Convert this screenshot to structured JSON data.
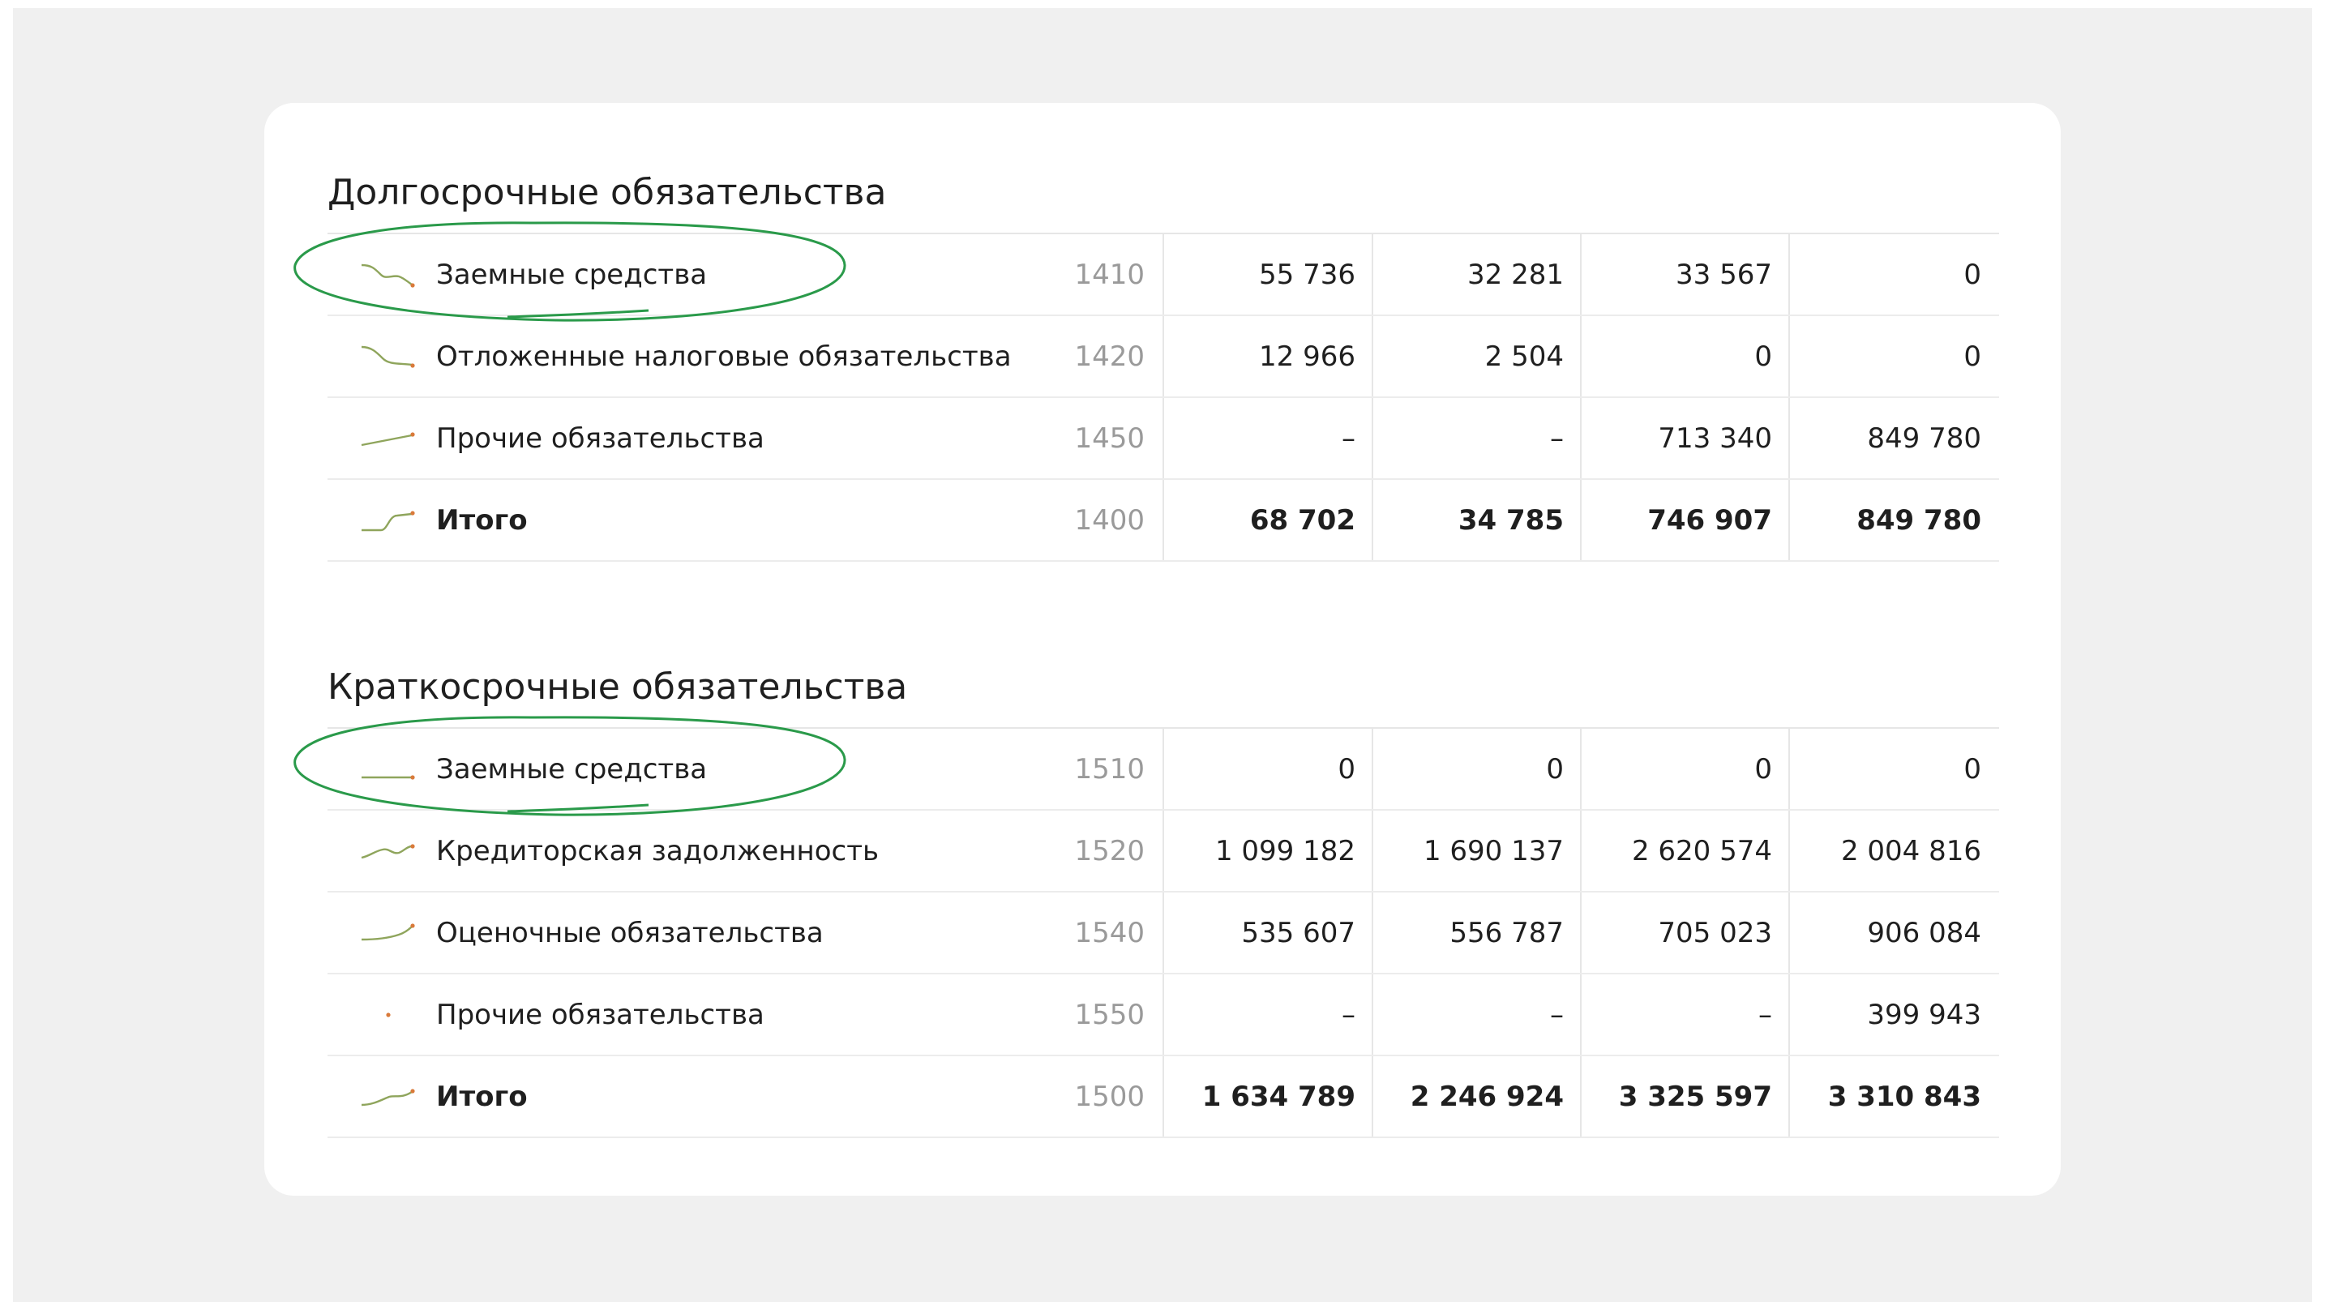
{
  "colors": {
    "accent_green": "#2a9a4a",
    "spark_stroke": "#8fa55c",
    "spark_dot": "#d97a3a"
  },
  "sections": [
    {
      "title": "Долгосрочные обязательства",
      "rows": [
        {
          "label": "Заемные средства",
          "code": "1410",
          "values": [
            "55 736",
            "32 281",
            "33 567",
            "0"
          ],
          "spark": "down-curve",
          "highlighted": true,
          "bold": false
        },
        {
          "label": "Отложенные налоговые обязательства",
          "code": "1420",
          "values": [
            "12 966",
            "2 504",
            "0",
            "0"
          ],
          "spark": "down-curve",
          "highlighted": false,
          "bold": false
        },
        {
          "label": "Прочие обязательства",
          "code": "1450",
          "values": [
            "–",
            "–",
            "713 340",
            "849 780"
          ],
          "spark": "up-line",
          "highlighted": false,
          "bold": false
        },
        {
          "label": "Итого",
          "code": "1400",
          "values": [
            "68 702",
            "34 785",
            "746 907",
            "849 780"
          ],
          "spark": "step-up",
          "highlighted": false,
          "bold": true
        }
      ]
    },
    {
      "title": "Краткосрочные обязательства",
      "rows": [
        {
          "label": "Заемные средства",
          "code": "1510",
          "values": [
            "0",
            "0",
            "0",
            "0"
          ],
          "spark": "flat",
          "highlighted": true,
          "bold": false
        },
        {
          "label": "Кредиторская задолженность",
          "code": "1520",
          "values": [
            "1 099 182",
            "1 690 137",
            "2 620 574",
            "2 004 816"
          ],
          "spark": "wave-up",
          "highlighted": false,
          "bold": false
        },
        {
          "label": "Оценочные обязательства",
          "code": "1540",
          "values": [
            "535 607",
            "556 787",
            "705 023",
            "906 084"
          ],
          "spark": "up-curve",
          "highlighted": false,
          "bold": false
        },
        {
          "label": "Прочие обязательства",
          "code": "1550",
          "values": [
            "–",
            "–",
            "–",
            "399 943"
          ],
          "spark": "dot",
          "highlighted": false,
          "bold": false
        },
        {
          "label": "Итого",
          "code": "1500",
          "values": [
            "1 634 789",
            "2 246 924",
            "3 325 597",
            "3 310 843"
          ],
          "spark": "up-curve",
          "highlighted": false,
          "bold": true
        }
      ]
    }
  ]
}
